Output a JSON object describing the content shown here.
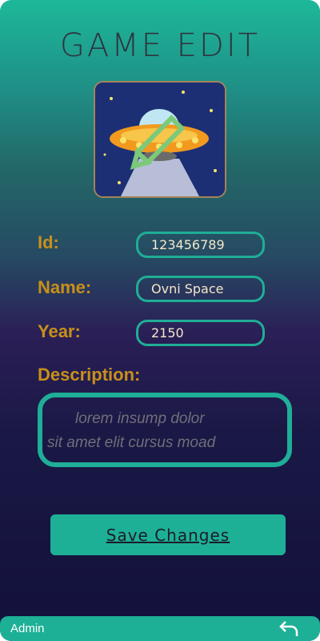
{
  "title": "GAME EDIT",
  "cover": {
    "description_icon": "ufo-game-cover",
    "edit_icon": "pencil-icon"
  },
  "fields": {
    "id": {
      "label": "Id:",
      "value": "123456789"
    },
    "name": {
      "label": "Name:",
      "value": "Ovni Space"
    },
    "year": {
      "label": "Year:",
      "value": "2150"
    },
    "description": {
      "label": "Description:",
      "line1": "lorem insump dolor",
      "line2": "sit amet elit cursus moad"
    }
  },
  "save_button": {
    "label": "Save Changes"
  },
  "footer": {
    "user": "Admin",
    "back_icon": "back-arrow-icon"
  },
  "colors": {
    "accent": "#1eb097",
    "label": "#c8901a",
    "field_text": "#f4e7c8"
  }
}
